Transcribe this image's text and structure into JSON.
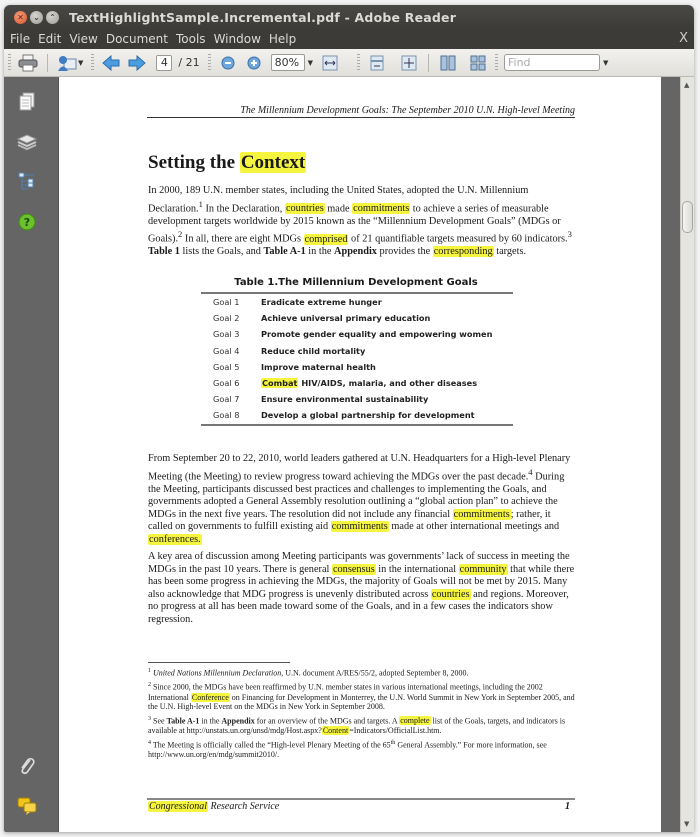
{
  "window": {
    "title": "TextHighlightSample.Incremental.pdf - Adobe Reader",
    "controls": [
      "close",
      "minimize",
      "maximize"
    ]
  },
  "menubar": {
    "items": [
      "File",
      "Edit",
      "View",
      "Document",
      "Tools",
      "Window",
      "Help"
    ],
    "close_glyph": "X"
  },
  "toolbar": {
    "current_page": "4",
    "total_pages": "/ 21",
    "zoom_value": "80%",
    "find_placeholder": "Find",
    "icons": [
      "print-icon",
      "share-email-icon",
      "previous-page-icon",
      "next-page-icon",
      "zoom-out-icon",
      "zoom-in-icon",
      "fit-width-icon",
      "fit-page-icon",
      "full-screen-icon",
      "two-page-icon",
      "continuous-icon"
    ]
  },
  "nav_panel": {
    "icons": [
      "pages-icon",
      "layers-icon",
      "structure-icon",
      "help-icon",
      "attachment-icon",
      "comments-icon"
    ]
  },
  "document": {
    "running_head": "The Millennium Development Goals: The September 2010 U.N. High-level Meeting",
    "section_title": {
      "before": "Setting the ",
      "highlight": "Context"
    },
    "highlight_color": "#f5f540",
    "para1": {
      "t1": "In 2000, 189 U.N. member states, including the United States, adopted the U.N. Millennium Declaration.",
      "s1": "1",
      "t2": " In the Declaration, ",
      "h1": "countries",
      "t3": " made ",
      "h2": "commitments",
      "t4": " to achieve a series of measurable development targets worldwide by 2015 known as the “Millennium Development Goals” (MDGs or Goals).",
      "s2": "2",
      "t5": " In all, there are eight MDGs ",
      "h3": "comprised",
      "t6": " of 21 quantifiable targets measured by 60 indicators.",
      "s3": "3",
      "t7": " ",
      "b1": "Table 1",
      "t8": " lists the Goals, and ",
      "b2": "Table A-1",
      "t9": " in the ",
      "b3": "Appendix",
      "t10": " provides the ",
      "h4": "corresponding",
      "t11": " targets."
    },
    "table": {
      "title": "Table 1.The Millennium Development Goals",
      "rows": [
        {
          "goal": "Goal 1",
          "desc_hl": "",
          "desc": "Eradicate extreme hunger"
        },
        {
          "goal": "Goal 2",
          "desc_hl": "",
          "desc": "Achieve universal primary education"
        },
        {
          "goal": "Goal 3",
          "desc_hl": "",
          "desc": "Promote gender equality and empowering women"
        },
        {
          "goal": "Goal 4",
          "desc_hl": "",
          "desc": "Reduce child mortality"
        },
        {
          "goal": "Goal 5",
          "desc_hl": "",
          "desc": "Improve maternal health"
        },
        {
          "goal": "Goal 6",
          "desc_hl": "Combat",
          "desc": " HIV/AIDS, malaria, and other diseases"
        },
        {
          "goal": "Goal 7",
          "desc_hl": "",
          "desc": "Ensure environmental sustainability"
        },
        {
          "goal": "Goal 8",
          "desc_hl": "",
          "desc": "Develop a global partnership for development"
        }
      ]
    },
    "para2": {
      "t1": "From September 20 to 22, 2010, world leaders gathered at U.N. Headquarters for a High-level Plenary Meeting (the Meeting) to review progress toward achieving the MDGs over the past decade.",
      "s1": "4",
      "t2": " During the Meeting, participants discussed best practices and challenges to implementing the Goals, and governments adopted a General Assembly resolution outlining a “global action plan” to achieve the MDGs in the next five years. The resolution did not include any financial ",
      "h1": "commitments",
      "t3": "; rather, it called on governments to fulfill existing aid ",
      "h2": "commitments",
      "t4": " made at other international meetings and ",
      "h3": "conferences.",
      "t5": ""
    },
    "para3": {
      "t1": "A key area of discussion among Meeting participants was governments’ lack of success in meeting the MDGs in the past 10 years. There is general ",
      "h1": "consensus",
      "t2": " in the international ",
      "h2": "community",
      "t3": " that while there has been some progress in achieving the MDGs, the majority of Goals will not be met by 2015. Many also acknowledge that MDG progress is unevenly distributed across ",
      "h3": "countries",
      "t4": " and regions. Moreover, no progress at all has been made toward some of the Goals, and in a few cases the indicators show regression."
    },
    "footnotes": {
      "fn1": {
        "num": "1",
        "italic": "United Nations Millennium Declaration",
        "text": ", U.N. document A/RES/55/2, adopted September 8, 2000."
      },
      "fn2": {
        "num": "2",
        "t1": " Since 2000, the MDGs have been reaffirmed by U.N. member states in various international meetings, including the 2002 International ",
        "h1": "Conference",
        "t2": " on Financing for Development in Monterrey, the U.N. World Summit in New York in September 2005, and the U.N. High-level Event on the MDGs in New York in September 2008."
      },
      "fn3": {
        "num": "3",
        "t1": " See ",
        "b1": "Table A-1",
        "t2": " in the ",
        "b2": "Appendix",
        "t3": " for an overview of the MDGs and targets. A ",
        "h1": "complete",
        "t4": " list of the Goals, targets, and indicators is available at http://unstats.un.org/unsd/mdg/Host.aspx?",
        "h2": "Content",
        "t5": "=Indicators/OfficialList.htm."
      },
      "fn4": {
        "num": "4",
        "t1": " The Meeting is officially called the “High-level Plenary Meeting of the 65",
        "sup": "th",
        "t2": " General Assembly.” For more information, see http://www.un.org/en/mdg/summit2010/."
      }
    },
    "footer": {
      "left_hl": "Congressional",
      "left": " Research Service",
      "page_number": "1"
    }
  }
}
